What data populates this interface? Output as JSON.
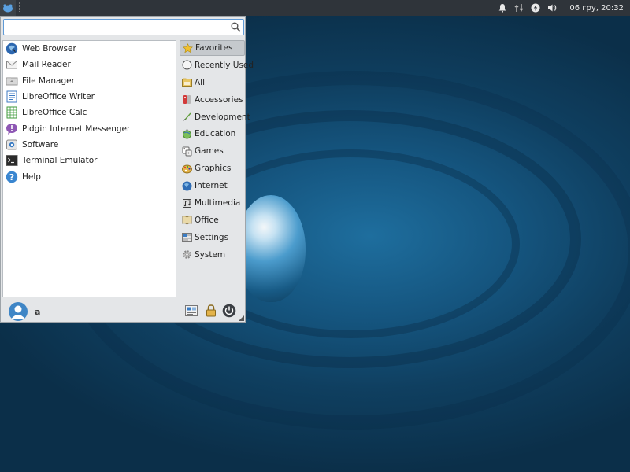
{
  "panel": {
    "clock": "06 гру, 20:32",
    "tray_icons": [
      "bell-icon",
      "network-transfer-icon",
      "power-icon",
      "volume-icon"
    ]
  },
  "search": {
    "value": "",
    "placeholder": ""
  },
  "favorites": [
    {
      "label": "Web Browser",
      "icon": "web-browser-icon"
    },
    {
      "label": "Mail Reader",
      "icon": "mail-icon"
    },
    {
      "label": "File Manager",
      "icon": "folder-icon"
    },
    {
      "label": "LibreOffice Writer",
      "icon": "writer-icon"
    },
    {
      "label": "LibreOffice Calc",
      "icon": "calc-icon"
    },
    {
      "label": "Pidgin Internet Messenger",
      "icon": "pidgin-icon"
    },
    {
      "label": "Software",
      "icon": "software-icon"
    },
    {
      "label": "Terminal Emulator",
      "icon": "terminal-icon"
    },
    {
      "label": "Help",
      "icon": "help-icon"
    }
  ],
  "categories": [
    {
      "label": "Favorites",
      "icon": "star-icon",
      "active": true
    },
    {
      "label": "Recently Used",
      "icon": "clock-icon"
    },
    {
      "label": "All",
      "icon": "all-icon"
    },
    {
      "label": "Accessories",
      "icon": "accessories-icon"
    },
    {
      "label": "Development",
      "icon": "development-icon"
    },
    {
      "label": "Education",
      "icon": "education-icon"
    },
    {
      "label": "Games",
      "icon": "games-icon"
    },
    {
      "label": "Graphics",
      "icon": "graphics-icon"
    },
    {
      "label": "Internet",
      "icon": "globe-icon"
    },
    {
      "label": "Multimedia",
      "icon": "multimedia-icon"
    },
    {
      "label": "Office",
      "icon": "office-icon"
    },
    {
      "label": "Settings",
      "icon": "settings-icon"
    },
    {
      "label": "System",
      "icon": "gear-icon"
    }
  ],
  "user": {
    "name": "a"
  },
  "colors": {
    "panel": "#2f343a",
    "menu_bg": "#e4e6e8",
    "accent": "#5f9ad6",
    "desktop": "#15557f"
  }
}
